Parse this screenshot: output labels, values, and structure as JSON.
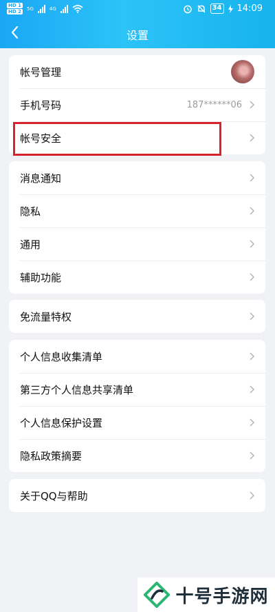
{
  "status_bar": {
    "sim1": "HD 1",
    "sim2": "HD 2",
    "network1": "5G",
    "network2": "4G",
    "battery": "34",
    "time": "14:09"
  },
  "header": {
    "title": "设置"
  },
  "sections": [
    {
      "items": [
        {
          "label": "帐号管理",
          "value": "",
          "has_avatar": true
        },
        {
          "label": "手机号码",
          "value": "187******06"
        },
        {
          "label": "帐号安全",
          "value": ""
        }
      ]
    },
    {
      "items": [
        {
          "label": "消息通知"
        },
        {
          "label": "隐私"
        },
        {
          "label": "通用"
        },
        {
          "label": "辅助功能"
        }
      ]
    },
    {
      "items": [
        {
          "label": "免流量特权"
        }
      ]
    },
    {
      "items": [
        {
          "label": "个人信息收集清单"
        },
        {
          "label": "第三方个人信息共享清单"
        },
        {
          "label": "个人信息保护设置"
        },
        {
          "label": "隐私政策摘要"
        }
      ]
    },
    {
      "items": [
        {
          "label": "关于QQ与帮助"
        }
      ]
    }
  ],
  "watermark": {
    "text": "十号手游网"
  },
  "colors": {
    "header_gradient_start": "#1aa7f5",
    "header_gradient_end": "#17b3ee",
    "highlight_border": "#d6222c",
    "page_background": "#f1f2f6"
  }
}
